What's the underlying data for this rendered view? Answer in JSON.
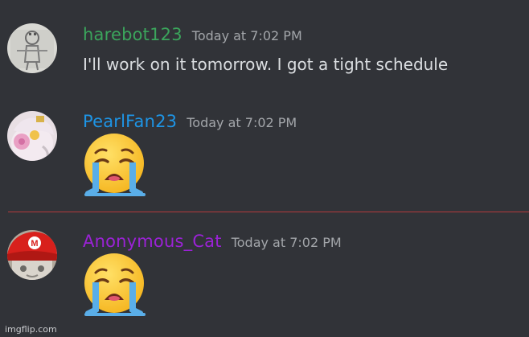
{
  "messages": [
    {
      "username": "harebot123",
      "username_color": "#3ba55c",
      "timestamp": "Today at 7:02 PM",
      "text": "I'll work on it tomorrow. I got a tight schedule"
    },
    {
      "username": "PearlFan23",
      "username_color": "#1e95e6",
      "timestamp": "Today at 7:02 PM",
      "emoji": "loudly-crying-face"
    },
    {
      "username": "Anonymous_Cat",
      "username_color": "#9b22d6",
      "timestamp": "Today at 7:02 PM",
      "emoji": "loudly-crying-face"
    }
  ],
  "divider_color": "#b23a3c",
  "watermark": "imgflip.com"
}
